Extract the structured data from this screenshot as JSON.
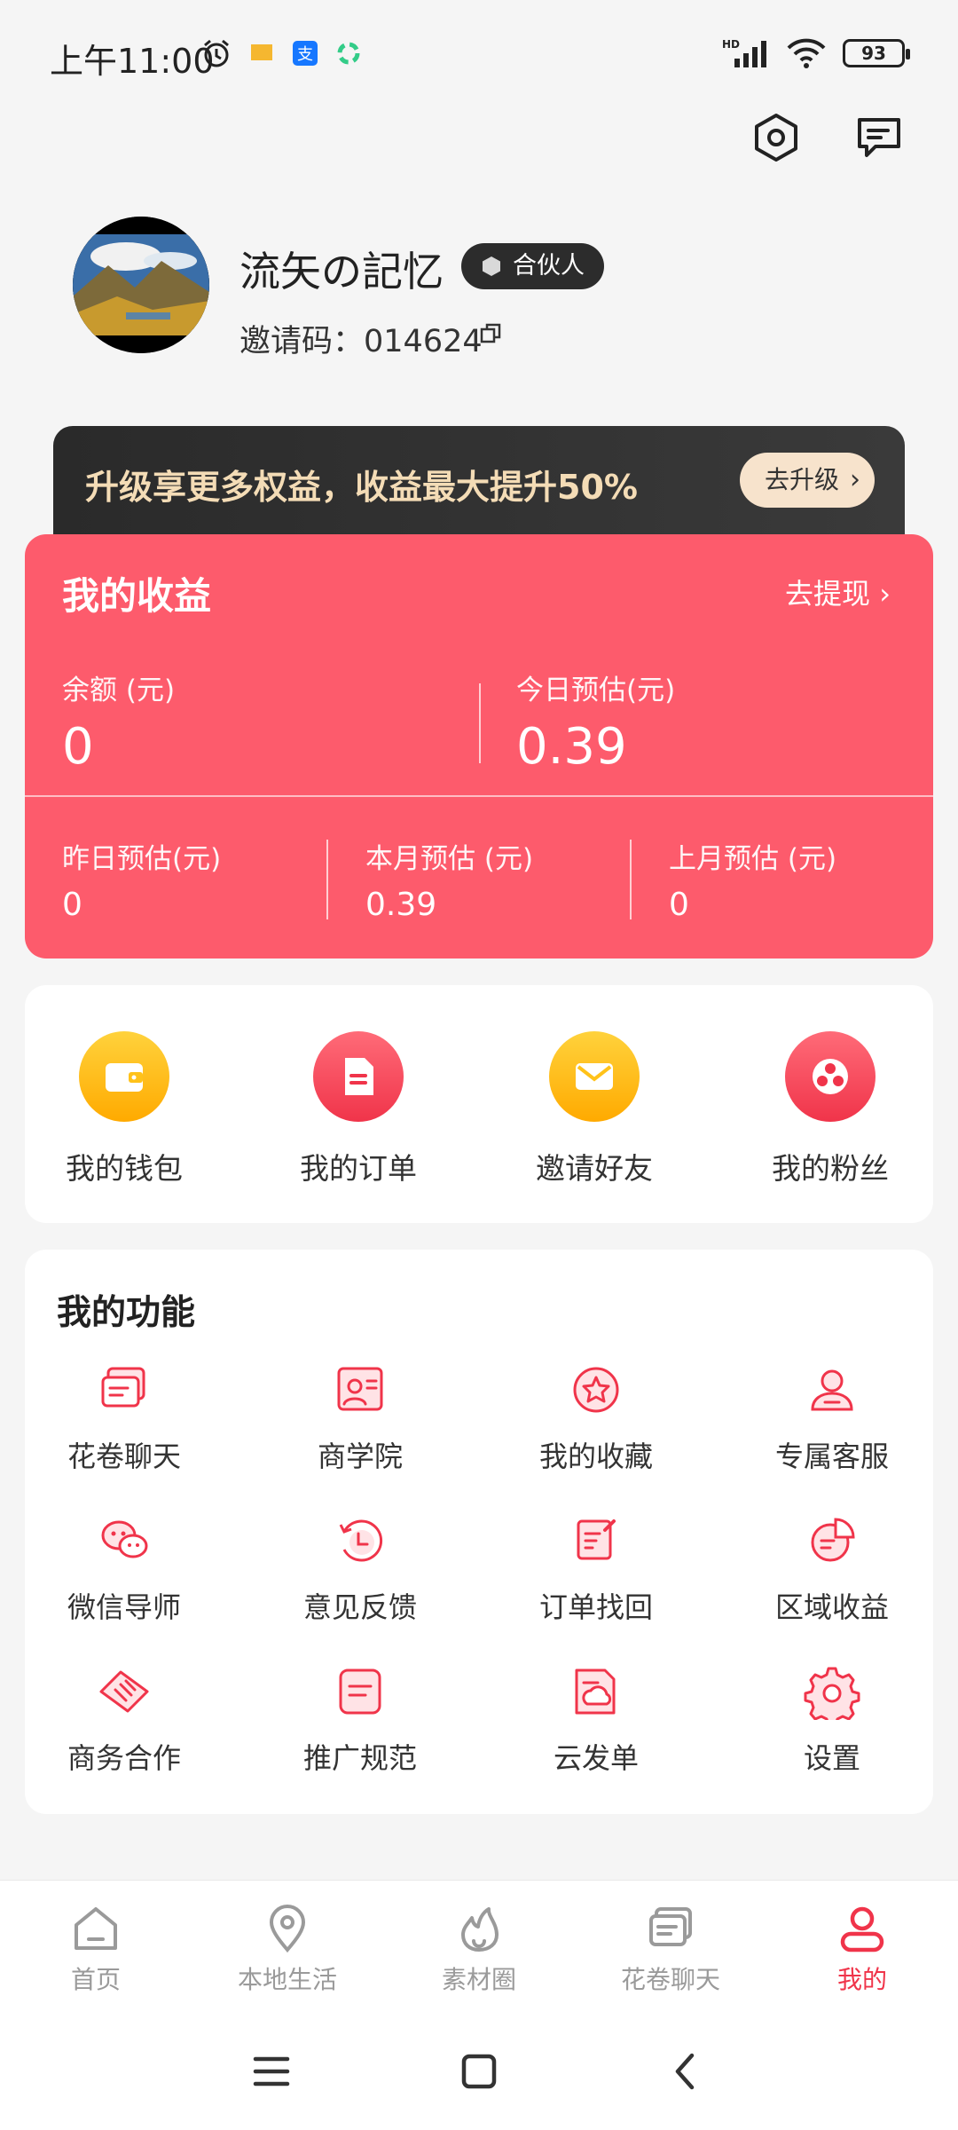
{
  "status_bar": {
    "time": "上午11:00",
    "battery": "93",
    "network": "HD"
  },
  "profile": {
    "nickname": "流矢の記忆",
    "badge": "合伙人",
    "invite_label": "邀请码：",
    "invite_code": "014624"
  },
  "upgrade": {
    "text": "升级享更多权益，收益最大提升50%",
    "button": "去升级"
  },
  "earnings": {
    "title": "我的收益",
    "withdraw": "去提现",
    "balance_label": "余额 (元)",
    "balance_value": "0",
    "today_label": "今日预估(元)",
    "today_value": "0.39",
    "yesterday_label": "昨日预估(元)",
    "yesterday_value": "0",
    "month_label": "本月预估 (元)",
    "month_value": "0.39",
    "last_month_label": "上月预估 (元)",
    "last_month_value": "0"
  },
  "quick_actions": [
    {
      "label": "我的钱包",
      "icon": "wallet-icon",
      "color": "#ffb400"
    },
    {
      "label": "我的订单",
      "icon": "order-icon",
      "color": "#f0344a"
    },
    {
      "label": "邀请好友",
      "icon": "mail-icon",
      "color": "#ffb400"
    },
    {
      "label": "我的粉丝",
      "icon": "fans-icon",
      "color": "#f0344a"
    }
  ],
  "functions": {
    "title": "我的功能",
    "items": [
      {
        "label": "花卷聊天",
        "icon": "chat-icon"
      },
      {
        "label": "商学院",
        "icon": "academy-icon"
      },
      {
        "label": "我的收藏",
        "icon": "star-icon"
      },
      {
        "label": "专属客服",
        "icon": "support-icon"
      },
      {
        "label": "微信导师",
        "icon": "wechat-icon"
      },
      {
        "label": "意见反馈",
        "icon": "feedback-icon"
      },
      {
        "label": "订单找回",
        "icon": "order-recover-icon"
      },
      {
        "label": "区域收益",
        "icon": "pie-chart-icon"
      },
      {
        "label": "商务合作",
        "icon": "handshake-icon"
      },
      {
        "label": "推广规范",
        "icon": "document-icon"
      },
      {
        "label": "云发单",
        "icon": "cloud-send-icon"
      },
      {
        "label": "设置",
        "icon": "gear-icon"
      }
    ]
  },
  "tabs": [
    {
      "label": "首页",
      "icon": "home-icon"
    },
    {
      "label": "本地生活",
      "icon": "location-icon"
    },
    {
      "label": "素材圈",
      "icon": "flame-icon"
    },
    {
      "label": "花卷聊天",
      "icon": "chat-icon"
    },
    {
      "label": "我的",
      "icon": "user-icon",
      "active": true
    }
  ],
  "colors": {
    "accent": "#f0344a",
    "earnings_bg": "#fd5b6c",
    "gold": "#ffb400"
  }
}
